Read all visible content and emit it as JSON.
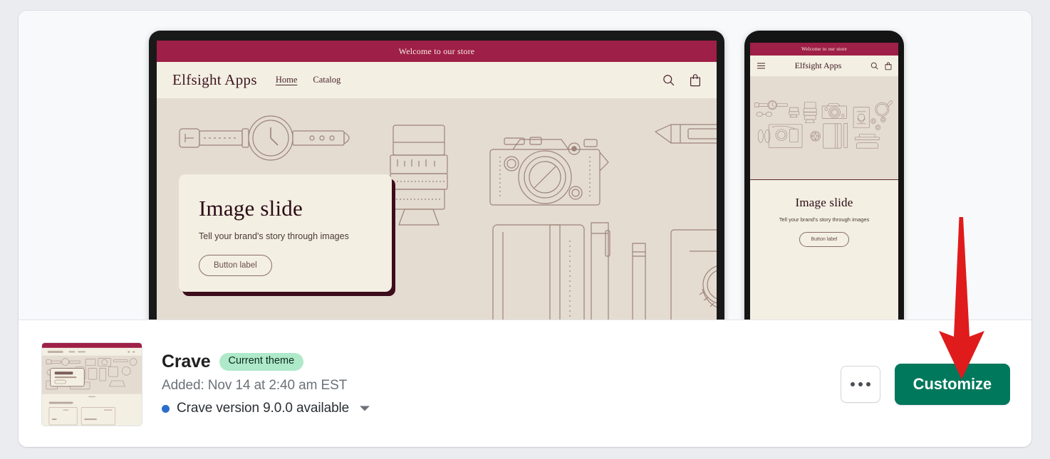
{
  "preview": {
    "desktop": {
      "device_name": "desktop-preview",
      "announcement": "Welcome to our store",
      "brand": "Elfsight Apps",
      "nav": [
        {
          "label": "Home",
          "active": true
        },
        {
          "label": "Catalog",
          "active": false
        }
      ],
      "icons": [
        "search-icon",
        "cart-icon"
      ],
      "slide": {
        "title": "Image slide",
        "subtitle": "Tell your brand's story through images",
        "button_label": "Button label"
      }
    },
    "mobile": {
      "device_name": "mobile-preview",
      "announcement": "Welcome to our store",
      "brand": "Elfsight Apps",
      "icons": [
        "hamburger-icon",
        "search-icon",
        "cart-icon"
      ],
      "slide": {
        "title": "Image slide",
        "subtitle": "Tell your brand's story through images",
        "button_label": "Button label"
      }
    }
  },
  "theme": {
    "name": "Crave",
    "badge": "Current theme",
    "added": "Added: Nov 14 at 2:40 am EST",
    "version_notice": "Crave version 9.0.0 available"
  },
  "actions": {
    "more_label": "...",
    "customize_label": "Customize"
  },
  "colors": {
    "page_background": "#ebecf0",
    "card_background": "#ffffff",
    "stage_background": "#f8f9fb",
    "announcement_bar": "#9e1f47",
    "storefront_surface": "#f3efe2",
    "storefront_hero": "#e4dcd1",
    "storefront_ink": "#6b4f4a",
    "badge_background": "#aee9c9",
    "customize_green": "#00785c",
    "version_dot_blue": "#2c6ecb",
    "annotation_arrow": "#e01b1b"
  }
}
